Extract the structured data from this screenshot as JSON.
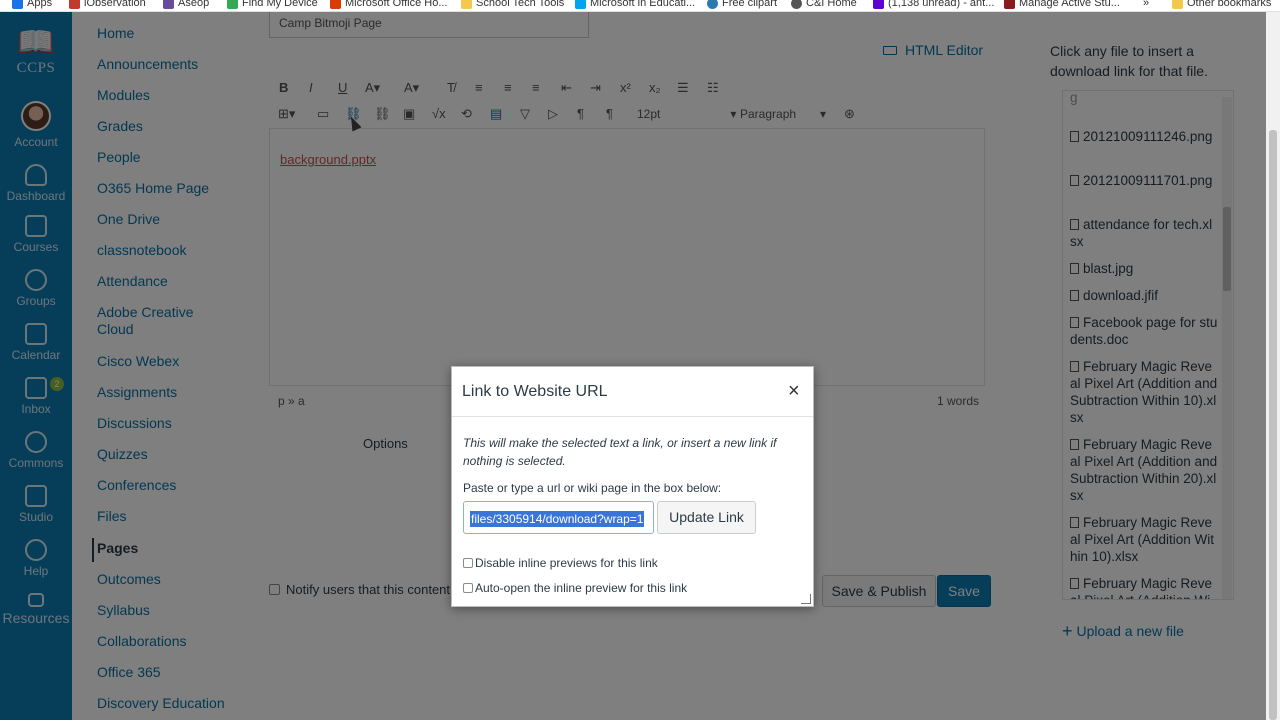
{
  "bookmarks": [
    {
      "label": "Apps",
      "color": "#1a73e8"
    },
    {
      "label": "iObservation",
      "color": "#c0392b"
    },
    {
      "label": "Aseop",
      "color": "#6a4c9c"
    },
    {
      "label": "Find My Device",
      "color": "#34a853"
    },
    {
      "label": "Microsoft Office Ho...",
      "color": "#d83b01"
    },
    {
      "label": "School Tech Tools",
      "color": "#f2c94c"
    },
    {
      "label": "Microsoft in Educati...",
      "color": "#00a4ef"
    },
    {
      "label": "Free clipart",
      "color": "#2a7ab0"
    },
    {
      "label": "C&I Home",
      "color": "#555555"
    },
    {
      "label": "(1,138 unread) - ant...",
      "color": "#6001d2"
    },
    {
      "label": "Manage Active Stu...",
      "color": "#8b1a1a"
    },
    {
      "label": "»",
      "color": ""
    },
    {
      "label": "Other bookmarks",
      "color": "#f2c94c"
    }
  ],
  "global_nav": {
    "logo_text": "CCPS",
    "items": [
      {
        "label": "Account",
        "icon": "avatar"
      },
      {
        "label": "Dashboard",
        "icon": "dashboard-icon"
      },
      {
        "label": "Courses",
        "icon": "courses-icon",
        "active": true
      },
      {
        "label": "Groups",
        "icon": "groups-icon"
      },
      {
        "label": "Calendar",
        "icon": "calendar-icon"
      },
      {
        "label": "Inbox",
        "icon": "inbox-icon",
        "badge": "2"
      },
      {
        "label": "Commons",
        "icon": "commons-icon"
      },
      {
        "label": "Studio",
        "icon": "studio-icon"
      },
      {
        "label": "Help",
        "icon": "help-icon"
      },
      {
        "label": "Resources",
        "icon": "resources-icon"
      }
    ]
  },
  "course_nav": {
    "items": [
      {
        "label": "Home",
        "hidden": false
      },
      {
        "label": "Announcements",
        "hidden": false
      },
      {
        "label": "Modules",
        "hidden": false
      },
      {
        "label": "Grades",
        "hidden": false
      },
      {
        "label": "People",
        "hidden": false
      },
      {
        "label": "O365 Home Page",
        "hidden": false
      },
      {
        "label": "One Drive",
        "hidden": false
      },
      {
        "label": "classnotebook",
        "hidden": false
      },
      {
        "label": "Attendance",
        "hidden": false
      },
      {
        "label": "Adobe Creative Cloud",
        "hidden": false
      },
      {
        "label": "Cisco Webex",
        "hidden": false
      },
      {
        "label": "Assignments",
        "hidden": true
      },
      {
        "label": "Discussions",
        "hidden": true
      },
      {
        "label": "Quizzes",
        "hidden": true
      },
      {
        "label": "Conferences",
        "hidden": true
      },
      {
        "label": "Files",
        "hidden": true
      },
      {
        "label": "Pages",
        "hidden": true,
        "active": true
      },
      {
        "label": "Outcomes",
        "hidden": true
      },
      {
        "label": "Syllabus",
        "hidden": true
      },
      {
        "label": "Collaborations",
        "hidden": true
      },
      {
        "label": "Office 365",
        "hidden": false
      },
      {
        "label": "Discovery Education",
        "hidden": false
      }
    ]
  },
  "editor": {
    "page_title": "Camp Bitmoji Page",
    "html_editor_label": "HTML Editor",
    "font_size": "12pt",
    "block_format": "Paragraph",
    "content_link": "background.pptx",
    "path": "p » a",
    "word_count": "1 words",
    "options_label": "Options",
    "notify_text": "Notify users that this content ha",
    "save_publish_label": "Save & Publish",
    "save_label": "Save"
  },
  "files_panel": {
    "hint": "Click any file to insert a download link for that file.",
    "files": [
      "20121009111246.png",
      "20121009111701.png",
      "attendance for tech.xlsx",
      "blast.jpg",
      "download.jfif",
      "Facebook page for students.doc",
      "February Magic Reveal Pixel Art (Addition and Subtraction Within 10).xlsx",
      "February Magic Reveal Pixel Art (Addition and Subtraction Within 20).xlsx",
      "February Magic Reveal Pixel Art (Addition Within 10).xlsx",
      "February Magic Reveal Pixel Art (Addition Wi"
    ],
    "upload_label": "Upload a new file"
  },
  "dialog": {
    "title": "Link to Website URL",
    "close_symbol": "×",
    "info_text": "This will make the selected text a link, or insert a new link if nothing is selected.",
    "prompt": "Paste or type a url or wiki page in the box below:",
    "url_value": "files/3305914/download?wrap=1",
    "update_button": "Update Link",
    "disable_previews_label": "Disable inline previews for this link",
    "auto_open_label": "Auto-open the inline preview for this link"
  }
}
